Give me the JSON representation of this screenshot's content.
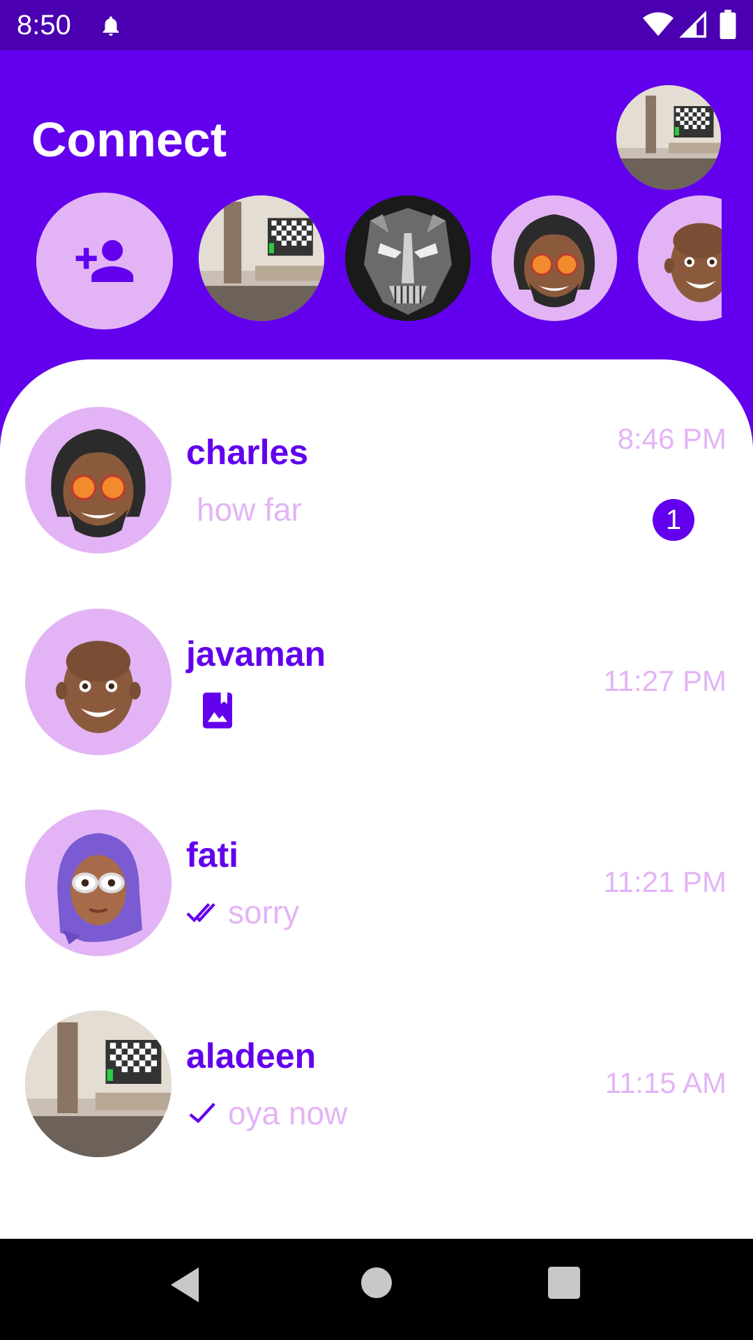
{
  "status_bar": {
    "time": "8:50"
  },
  "header": {
    "title": "Connect"
  },
  "stories": {
    "add_icon": "person-add-icon",
    "items": [
      {
        "kind": "room-photo"
      },
      {
        "kind": "monochrome-mask"
      },
      {
        "kind": "memoji-dreadlocks"
      },
      {
        "kind": "memoji-bald"
      }
    ]
  },
  "chats": [
    {
      "name": "charles",
      "preview": "how far",
      "time": "8:46 PM",
      "unread": "1",
      "avatar": "memoji-dreadlocks",
      "status": "none"
    },
    {
      "name": "javaman",
      "preview": "",
      "time": "11:27 PM",
      "avatar": "memoji-bald",
      "status": "photo-icon"
    },
    {
      "name": "fati",
      "preview": "sorry",
      "time": "11:21 PM",
      "avatar": "memoji-hijab",
      "status": "double-check-icon"
    },
    {
      "name": "aladeen",
      "preview": "oya now",
      "time": "11:15 AM",
      "avatar": "room-photo",
      "status": "check-icon"
    }
  ],
  "colors": {
    "primary": "#6200ee",
    "status_bar": "#4a00b0",
    "accent_light": "#e3b4f5",
    "background": "#ffffff"
  }
}
